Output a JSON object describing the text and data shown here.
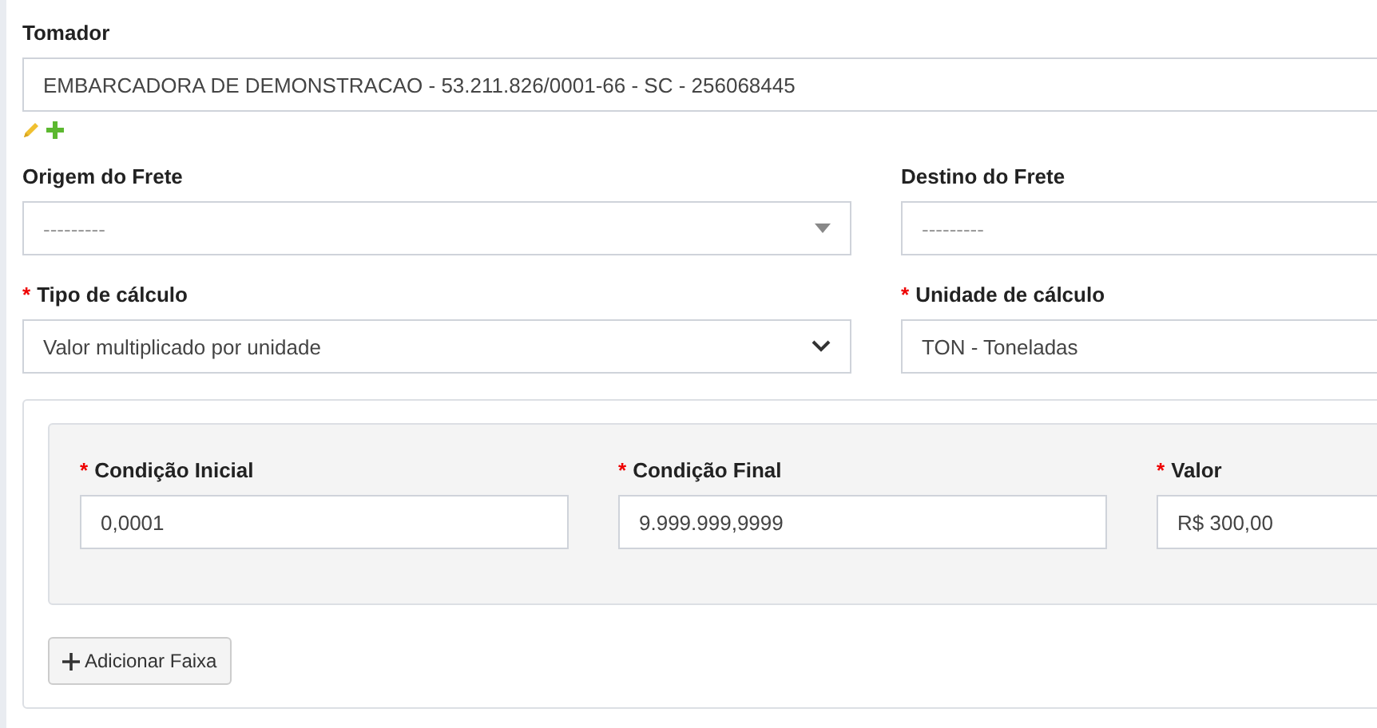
{
  "tomador": {
    "label": "Tomador",
    "kind": "text",
    "value": "EMBARCADORA DE DEMONSTRACAO - 53.211.826/0001-66 - SC - 256068445"
  },
  "rows": [
    [
      {
        "label": "Origem do Frete",
        "kind": "combo",
        "placeholder": "---------"
      },
      {
        "label": "Destino do Frete",
        "kind": "text",
        "placeholder": "---------"
      }
    ],
    [
      {
        "required_mark": "*",
        "label": "Tipo de cálculo",
        "kind": "select",
        "value": "Valor multiplicado por unidade"
      },
      {
        "required_mark": "*",
        "label": "Unidade de cálculo",
        "kind": "text",
        "value": "TON - Toneladas"
      }
    ]
  ],
  "faixa": [
    {
      "required_mark": "*",
      "label": "Condição Inicial",
      "kind": "text",
      "value": "0,0001"
    },
    {
      "required_mark": "*",
      "label": "Condição Final",
      "kind": "text",
      "value": "9.999.999,9999"
    },
    {
      "required_mark": "*",
      "label": "Valor",
      "kind": "text",
      "value": "R$ 300,00"
    }
  ],
  "add_button": {
    "label": "Adicionar Faixa"
  }
}
